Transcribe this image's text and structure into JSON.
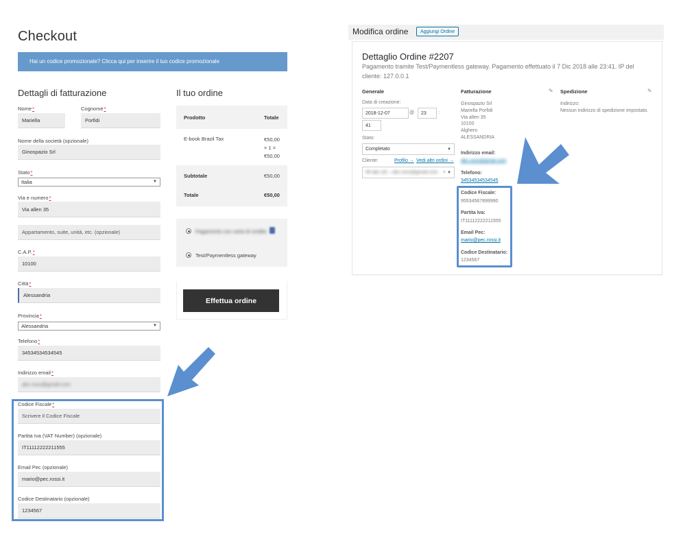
{
  "checkout": {
    "title": "Checkout",
    "promo": "Hai un codice promozionale? Clicca qui per inserire il tuo codice promozionale",
    "billing_heading": "Dettagli di fatturazione",
    "order_heading": "Il tuo ordine",
    "fields": {
      "nome_label": "Nome",
      "nome_value": "Mariella",
      "cognome_label": "Cognome",
      "cognome_value": "Porfidi",
      "societa_label": "Nome della società (opzionale)",
      "societa_value": "Ginospazio Srl",
      "stato_label": "Stato",
      "stato_value": "Italia",
      "via_label": "Via e numero",
      "via_value": "Via allen 35",
      "appartamento_placeholder": "Appartamento, suite, unità, etc. (opzionale)",
      "cap_label": "C.A.P.",
      "cap_value": "10100",
      "citta_label": "Città",
      "citta_value": "Alessandria",
      "provincia_label": "Provincia",
      "provincia_value": "Alessandria",
      "telefono_label": "Telefono",
      "telefono_value": "34534534534545",
      "email_label": "Indirizzo email",
      "email_value": "abc.xxxx@gmail.com",
      "cf_label": "Codice Fiscale",
      "cf_placeholder": "Scrivere il Codice Fiscale",
      "piva_label": "Partita Iva (VAT Number) (opzionale)",
      "piva_value": "IT11112222211555",
      "pec_label": "Email Pec (opzionale)",
      "pec_value": "mario@pec.rossi.it",
      "sdi_label": "Codice Destinatario (opzionale)",
      "sdi_value": "1234567"
    },
    "required_mark": "*",
    "order": {
      "col_product": "Prodotto",
      "col_total": "Totale",
      "product_name": "E-book Brazil Tax",
      "product_price": "€50,00",
      "product_qty": "× 1 =",
      "product_line_total": "€50,00",
      "subtotal_label": "Subtotale",
      "subtotal_value": "€50,00",
      "total_label": "Totale",
      "total_value": "€50,00",
      "payment_blurred": "Pagamento con carta di credito",
      "payment_option": "Test/Paymentless gateway",
      "place_order": "Effettua ordine"
    }
  },
  "admin": {
    "title": "Modifica ordine",
    "add_button": "Aggiungi Ordine",
    "order_heading": "Dettaglio Ordine #2207",
    "order_sub": "Pagamento tramite Test/Paymentless gateway. Pagamento effettuato il 7 Dic 2018 alle 23:41. IP del cliente: 127.0.0.1",
    "generale": {
      "heading": "Generale",
      "date_label": "Data di creazione:",
      "date_value": "2018-12-07",
      "at": "@",
      "hour": "23",
      "colon": ":",
      "minute": "41",
      "status_label": "Stato:",
      "status_value": "Completato",
      "client_label": "Cliente:",
      "profile_link": "Profilo →",
      "other_orders_link": "Vedi altri ordini →",
      "client_value": "## abc (#) – abc.xxxx@gmail.com"
    },
    "fatturazione": {
      "heading": "Fatturazione",
      "address_lines": [
        "Ginospazio Srl",
        "Mariella Porfidi",
        "Via allen 35",
        "10100",
        "Alghero",
        "ALESSANDRIA"
      ],
      "email_label": "Indirizzo email:",
      "email_value": "abc.xxxx@gmail.com",
      "phone_label": "Telefono:",
      "phone_value": "34534534534545",
      "cf_label": "Codice Fiscale:",
      "cf_value": "95534567899990",
      "piva_label": "Partita Iva:",
      "piva_value": "IT11112222211555",
      "pec_label": "Email Pec:",
      "pec_value": "mario@pec.rossi.it",
      "sdi_label": "Codice Destinatario:",
      "sdi_value": "1234567"
    },
    "spedizione": {
      "heading": "Spedizione",
      "address_label": "Indirizzo:",
      "address_value": "Nessun indirizzo di spedizione impostato."
    }
  },
  "colors": {
    "promo_bg": "#6699cc",
    "highlight": "#5b8fcf",
    "button_dark": "#333333",
    "link": "#0073aa"
  }
}
